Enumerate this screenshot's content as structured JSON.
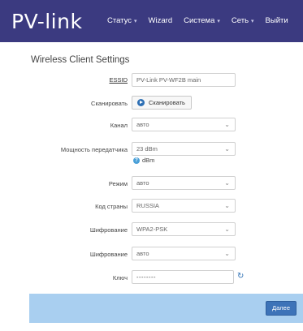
{
  "header": {
    "logo": "PV-link",
    "menu": [
      {
        "label": "Статус",
        "caret": "▾"
      },
      {
        "label": "Wizard",
        "caret": ""
      },
      {
        "label": "Система",
        "caret": "▾"
      },
      {
        "label": "Сеть",
        "caret": "▾"
      },
      {
        "label": "Выйти",
        "caret": ""
      }
    ]
  },
  "form": {
    "title": "Wireless Client Settings",
    "essid": {
      "label": "ESSID",
      "value": "PV-Link PV-WF2B main"
    },
    "scan": {
      "label": "Сканировать",
      "button": "Сканировать"
    },
    "channel": {
      "label": "Канал",
      "value": "авто"
    },
    "tx_power": {
      "label": "Мощность передатчика",
      "value": "23 dBm",
      "hint": "dBm"
    },
    "mode": {
      "label": "Режим",
      "value": "авто"
    },
    "country": {
      "label": "Код страны",
      "value": "RUSSIA"
    },
    "encryption": {
      "label": "Шифрование",
      "value": "WPA2-PSK"
    },
    "cipher": {
      "label": "Шифрование",
      "value": "авто"
    },
    "key": {
      "label": "Ключ",
      "value": "--------"
    }
  },
  "footer": {
    "next_label": "Далее"
  },
  "icons": {
    "scan": "play-circle-icon",
    "hint": "question-circle-icon",
    "refresh": "refresh-icon",
    "dropdown": "chevron-down-icon"
  },
  "colors": {
    "navbar": "#3b3a80",
    "footer": "#a9cff0",
    "primary": "#3d73b8"
  }
}
